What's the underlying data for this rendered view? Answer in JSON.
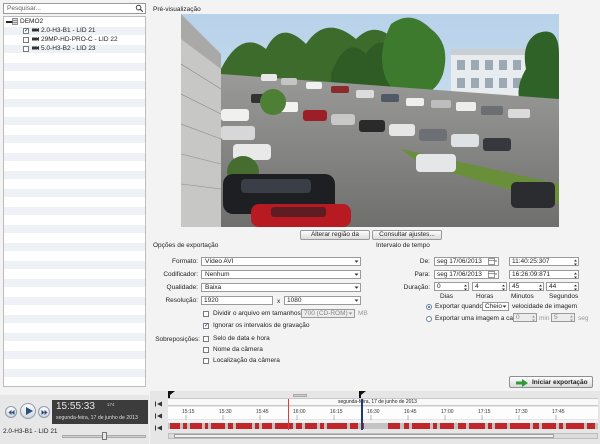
{
  "search": {
    "placeholder": "Pesquisar..."
  },
  "tree": {
    "root": "DEMO2",
    "cameras": [
      {
        "label": "2.0-H3-B1 - LID 21",
        "checked": true
      },
      {
        "label": "29MP-HD-PRO-C - LID 22",
        "checked": false
      },
      {
        "label": "5.0-H3-B2 - LID 23",
        "checked": false
      }
    ]
  },
  "preview": {
    "label": "Pré-visualização",
    "adjust_region_button": "Alterar região da",
    "view_settings_button": "Consultar ajustes..."
  },
  "export_options": {
    "title": "Opções de exportação",
    "format_label": "Formato:",
    "format_value": "Vídeo AVI",
    "codec_label": "Codificador:",
    "codec_value": "Nenhum",
    "quality_label": "Qualidade:",
    "quality_value": "Baixa",
    "resolution_label": "Resolução:",
    "res_width": "1920",
    "res_x": "x",
    "res_height": "1080",
    "split_label": "Dividir o arquivo em tamanhos de:",
    "split_value": "700 (CD-ROM)",
    "split_unit": "MB",
    "ignore_label": "Ignorar os intervalos de gravação",
    "overlays_label": "Sobreposições:",
    "overlay_date": "Selo de data e hora",
    "overlay_camname": "Nome da câmera",
    "overlay_location": "Localização da câmera"
  },
  "time_range": {
    "title": "Intervalo de tempo",
    "from_label": "De:",
    "from_date": "seg  17/06/2013",
    "from_time": "11:40:25:307",
    "to_label": "Para:",
    "to_date": "seg  17/06/2013",
    "to_time": "16:26:09:871",
    "duration_label": "Duração:",
    "days": "0",
    "hours": "4",
    "minutes": "45",
    "seconds": "44",
    "days_label": "Dias",
    "hours_label": "Horas",
    "minutes_label": "Minutos",
    "seconds_label": "Segundos",
    "export_when_label": "Exportar quando",
    "export_when_value": "Cheio",
    "image_speed_label": "velocidade de imagem",
    "export_one_label": "Exportar uma imagem a cada",
    "every_min": "0",
    "min_unit": "min",
    "every_sec": "5",
    "sec_unit": "seg"
  },
  "start_export_button": "Iniciar exportação",
  "player": {
    "time": "15:55:33",
    "millis": "174",
    "date": "segunda-feira, 17 de junho de 2013",
    "camera": "2.0-H3-B1 - LID 21"
  },
  "timeline": {
    "date_header": "segunda-feira, 17 de junho de 2013",
    "ticks": [
      "15:15",
      "15:30",
      "15:45",
      "16:00",
      "16:15",
      "16:30",
      "16:45",
      "17:00",
      "17:15",
      "17:30",
      "17:45"
    ]
  },
  "colors": {
    "accent_green": "#2e9b3a",
    "timeline_red": "#c0262a",
    "timeline_cursor": "#e23b3b"
  }
}
